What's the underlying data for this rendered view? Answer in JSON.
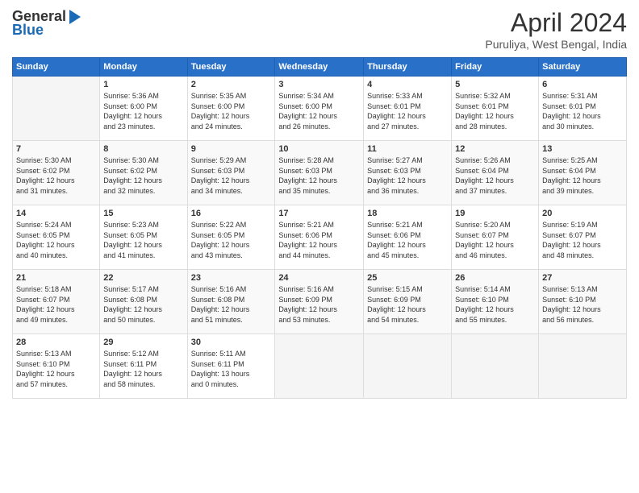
{
  "header": {
    "logo_general": "General",
    "logo_blue": "Blue",
    "title": "April 2024",
    "location": "Puruliya, West Bengal, India"
  },
  "days_of_week": [
    "Sunday",
    "Monday",
    "Tuesday",
    "Wednesday",
    "Thursday",
    "Friday",
    "Saturday"
  ],
  "weeks": [
    [
      {
        "day": "",
        "info": ""
      },
      {
        "day": "1",
        "info": "Sunrise: 5:36 AM\nSunset: 6:00 PM\nDaylight: 12 hours\nand 23 minutes."
      },
      {
        "day": "2",
        "info": "Sunrise: 5:35 AM\nSunset: 6:00 PM\nDaylight: 12 hours\nand 24 minutes."
      },
      {
        "day": "3",
        "info": "Sunrise: 5:34 AM\nSunset: 6:00 PM\nDaylight: 12 hours\nand 26 minutes."
      },
      {
        "day": "4",
        "info": "Sunrise: 5:33 AM\nSunset: 6:01 PM\nDaylight: 12 hours\nand 27 minutes."
      },
      {
        "day": "5",
        "info": "Sunrise: 5:32 AM\nSunset: 6:01 PM\nDaylight: 12 hours\nand 28 minutes."
      },
      {
        "day": "6",
        "info": "Sunrise: 5:31 AM\nSunset: 6:01 PM\nDaylight: 12 hours\nand 30 minutes."
      }
    ],
    [
      {
        "day": "7",
        "info": "Sunrise: 5:30 AM\nSunset: 6:02 PM\nDaylight: 12 hours\nand 31 minutes."
      },
      {
        "day": "8",
        "info": "Sunrise: 5:30 AM\nSunset: 6:02 PM\nDaylight: 12 hours\nand 32 minutes."
      },
      {
        "day": "9",
        "info": "Sunrise: 5:29 AM\nSunset: 6:03 PM\nDaylight: 12 hours\nand 34 minutes."
      },
      {
        "day": "10",
        "info": "Sunrise: 5:28 AM\nSunset: 6:03 PM\nDaylight: 12 hours\nand 35 minutes."
      },
      {
        "day": "11",
        "info": "Sunrise: 5:27 AM\nSunset: 6:03 PM\nDaylight: 12 hours\nand 36 minutes."
      },
      {
        "day": "12",
        "info": "Sunrise: 5:26 AM\nSunset: 6:04 PM\nDaylight: 12 hours\nand 37 minutes."
      },
      {
        "day": "13",
        "info": "Sunrise: 5:25 AM\nSunset: 6:04 PM\nDaylight: 12 hours\nand 39 minutes."
      }
    ],
    [
      {
        "day": "14",
        "info": "Sunrise: 5:24 AM\nSunset: 6:05 PM\nDaylight: 12 hours\nand 40 minutes."
      },
      {
        "day": "15",
        "info": "Sunrise: 5:23 AM\nSunset: 6:05 PM\nDaylight: 12 hours\nand 41 minutes."
      },
      {
        "day": "16",
        "info": "Sunrise: 5:22 AM\nSunset: 6:05 PM\nDaylight: 12 hours\nand 43 minutes."
      },
      {
        "day": "17",
        "info": "Sunrise: 5:21 AM\nSunset: 6:06 PM\nDaylight: 12 hours\nand 44 minutes."
      },
      {
        "day": "18",
        "info": "Sunrise: 5:21 AM\nSunset: 6:06 PM\nDaylight: 12 hours\nand 45 minutes."
      },
      {
        "day": "19",
        "info": "Sunrise: 5:20 AM\nSunset: 6:07 PM\nDaylight: 12 hours\nand 46 minutes."
      },
      {
        "day": "20",
        "info": "Sunrise: 5:19 AM\nSunset: 6:07 PM\nDaylight: 12 hours\nand 48 minutes."
      }
    ],
    [
      {
        "day": "21",
        "info": "Sunrise: 5:18 AM\nSunset: 6:07 PM\nDaylight: 12 hours\nand 49 minutes."
      },
      {
        "day": "22",
        "info": "Sunrise: 5:17 AM\nSunset: 6:08 PM\nDaylight: 12 hours\nand 50 minutes."
      },
      {
        "day": "23",
        "info": "Sunrise: 5:16 AM\nSunset: 6:08 PM\nDaylight: 12 hours\nand 51 minutes."
      },
      {
        "day": "24",
        "info": "Sunrise: 5:16 AM\nSunset: 6:09 PM\nDaylight: 12 hours\nand 53 minutes."
      },
      {
        "day": "25",
        "info": "Sunrise: 5:15 AM\nSunset: 6:09 PM\nDaylight: 12 hours\nand 54 minutes."
      },
      {
        "day": "26",
        "info": "Sunrise: 5:14 AM\nSunset: 6:10 PM\nDaylight: 12 hours\nand 55 minutes."
      },
      {
        "day": "27",
        "info": "Sunrise: 5:13 AM\nSunset: 6:10 PM\nDaylight: 12 hours\nand 56 minutes."
      }
    ],
    [
      {
        "day": "28",
        "info": "Sunrise: 5:13 AM\nSunset: 6:10 PM\nDaylight: 12 hours\nand 57 minutes."
      },
      {
        "day": "29",
        "info": "Sunrise: 5:12 AM\nSunset: 6:11 PM\nDaylight: 12 hours\nand 58 minutes."
      },
      {
        "day": "30",
        "info": "Sunrise: 5:11 AM\nSunset: 6:11 PM\nDaylight: 13 hours\nand 0 minutes."
      },
      {
        "day": "",
        "info": ""
      },
      {
        "day": "",
        "info": ""
      },
      {
        "day": "",
        "info": ""
      },
      {
        "day": "",
        "info": ""
      }
    ]
  ]
}
